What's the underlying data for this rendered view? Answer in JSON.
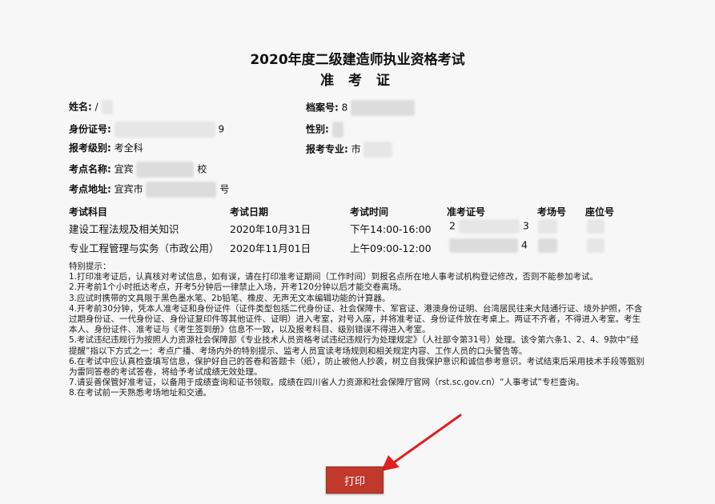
{
  "titles": {
    "main": "2020年度二级建造师执业资格考试",
    "sub": "准 考 证"
  },
  "candidate": {
    "name_label": "姓名:",
    "name_value": "/",
    "file_no_label": "档案号:",
    "file_no_value": "8",
    "id_label": "身份证号:",
    "id_value": "9",
    "gender_label": "性别:",
    "level_label": "报考级别:",
    "level_value": "考全科",
    "major_label": "报考专业:",
    "major_value": "市",
    "site_name_label": "考点名称:",
    "site_name_value_start": "宜宾",
    "site_name_value_end": "校",
    "site_addr_label": "考点地址:",
    "site_addr_value_start": "宜宾市",
    "site_addr_value_end": "号"
  },
  "table": {
    "headers": [
      "考试科目",
      "考试日期",
      "考试时间",
      "准考证号",
      "考场号",
      "座位号"
    ],
    "rows": [
      {
        "subject": "建设工程法规及相关知识",
        "date": "2020年10月31日",
        "time": "下午14:00-16:00",
        "ticket_start": "2",
        "ticket_end": "3"
      },
      {
        "subject": "专业工程管理与实务（市政公用）",
        "date": "2020年11月01日",
        "time": "上午09:00-12:00",
        "ticket_start": "",
        "ticket_end": "4"
      }
    ]
  },
  "notes": {
    "heading": "特别提示：",
    "items": [
      "1.打印准考证后，认真核对考试信息，如有误，请在打印准考证期间（工作时间）到报名点所在地人事考试机构登记修改，否则不能参加考试。",
      "2.开考前1个小时抵达考点，开考5分钟后一律禁止入场，开考120分钟以后才能交卷离场。",
      "3.应试时携带的文具限于黑色墨水笔、2b铅笔、橡皮、无声无文本编辑功能的计算器。",
      "4.开考前30分钟，凭本人准考证和身份证件（证件类型包括二代身份证、社会保障卡、军官证、港澳身份证明、台湾居民往来大陆通行证、境外护照，不含过期身份证、一代身份证、身份证复印件等其他证件、证明）进入考室，对号入座，并将准考证、身份证件放在考桌上。两证不齐者，不得进入考室。考生本人、身份证件、准考证与《考生签到册》信息不一致，以及报考科目、级别错误不得进入考室。",
      "5.考试违纪违规行为按照人力资源社会保障部《专业技术人员资格考试违纪违规行为处理规定》（人社部令第31号）处理。该令第六条1、2、4、9款中“经提醒”指以下方式之一：考点广播、考场内外的特别提示、监考人员宣读考场规则和相关规定内容、工作人员的口头警告等。",
      "6.在考试中应认真检查填写信息，保护好自己的答卷和答题卡（纸），防止被他人抄袭，树立自我保护意识和诚信参考意识。考试结束后采用技术手段等甄别为雷同答卷的考试答卷，将给予考试成绩无效处理。",
      "7.请妥善保管好准考证，以备用于成绩查询和证书领取。成绩在四川省人力资源和社会保障厅官网（rst.sc.gov.cn）“人事考试”专栏查询。",
      "8.在考试前一天熟悉考场地址和交通。"
    ]
  },
  "actions": {
    "print_label": "打印"
  },
  "colors": {
    "print_button": "#c0392b",
    "arrow": "#e02020"
  }
}
